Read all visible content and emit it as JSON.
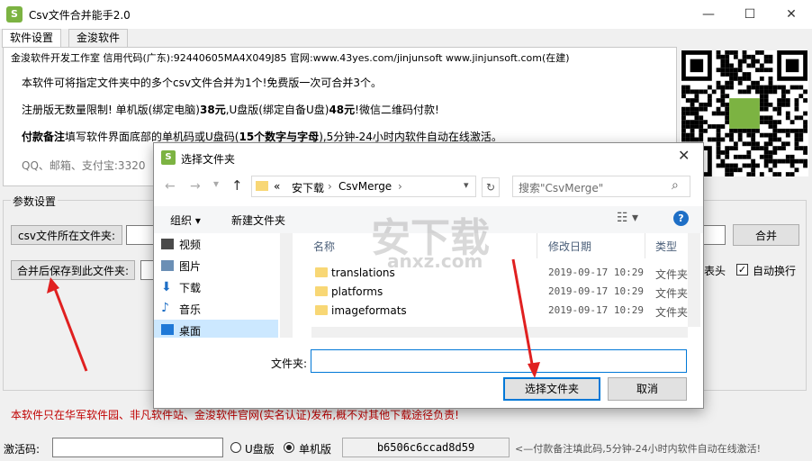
{
  "window": {
    "title": "Csv文件合并能手2.0",
    "logo": "S"
  },
  "tabs": [
    "软件设置",
    "金浚软件"
  ],
  "info": {
    "line1": "金浚软件开发工作室 信用代码(广东):92440605MA4X049J85 官网:www.43yes.com/jinjunsoft  www.jinjunsoft.com(在建)",
    "line2": "本软件可将指定文件夹中的多个csv文件合并为1个!免费版一次可合并3个。",
    "line3a": "注册版无数量限制! 单机版(绑定电脑)",
    "line3b": "38元",
    "line3c": ",U盘版(绑定自备U盘)",
    "line3d": "48元",
    "line3e": "!微信二维码付款!",
    "line4a": "付款备注",
    "line4b": "填写软件界面底部的单机码或U盘码(",
    "line4c": "15个数字与字母",
    "line4d": "),5分钟-24小时内软件自动在线激活。",
    "line5": "QQ、邮箱、支付宝:3320"
  },
  "params": {
    "label": "参数设置",
    "csv_folder_btn": "csv文件所在文件夹:",
    "save_folder_btn": "合并后保存到此文件夹:",
    "merge_btn": "合并",
    "header_chk": "表头",
    "autowrap_chk": "自动换行"
  },
  "bottom_note": "本软件只在华军软件园、非凡软件站、金浚软件官网(实名认证)发布,概不对其他下载途径负责!",
  "status": {
    "activation_label": "激活码:",
    "usb_label": "U盘版",
    "single_label": "单机版",
    "machine_code": "b6506c6ccad8d59",
    "hint": "<—付款备注填此码,5分钟-24小时内软件自动在线激活!"
  },
  "dialog": {
    "title": "选择文件夹",
    "path": [
      "«",
      "安下载",
      "CsvMerge"
    ],
    "search_placeholder": "搜索\"CsvMerge\"",
    "organize": "组织 ▾",
    "new_folder": "新建文件夹",
    "nav_items": [
      "视频",
      "图片",
      "下载",
      "音乐",
      "桌面"
    ],
    "columns": {
      "name": "名称",
      "date": "修改日期",
      "type": "类型"
    },
    "files": [
      {
        "name": "translations",
        "date": "2019-09-17 10:29",
        "type": "文件夹"
      },
      {
        "name": "platforms",
        "date": "2019-09-17 10:29",
        "type": "文件夹"
      },
      {
        "name": "imageformats",
        "date": "2019-09-17 10:29",
        "type": "文件夹"
      }
    ],
    "folder_label": "文件夹:",
    "select_btn": "选择文件夹",
    "cancel_btn": "取消"
  },
  "watermark": {
    "text": "安下载",
    "sub": "anxz.com"
  },
  "colors": {
    "accent": "#0078d7",
    "warning": "#c00000",
    "arrow": "#e02020",
    "logo": "#7cb342"
  }
}
